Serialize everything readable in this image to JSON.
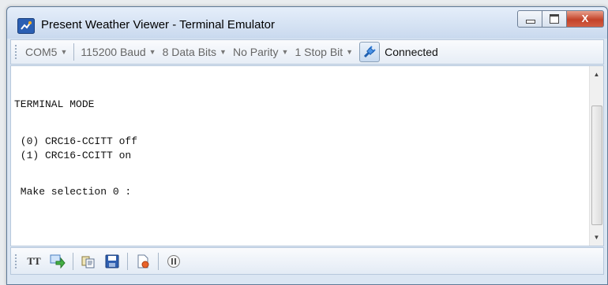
{
  "window": {
    "title": "Present Weather Viewer - Terminal Emulator",
    "close_glyph": "X"
  },
  "toolbar": {
    "port": "COM5",
    "baud": "115200 Baud",
    "data_bits": "8 Data Bits",
    "parity": "No Parity",
    "stop_bits": "1 Stop Bit",
    "connection_status": "Connected",
    "connection_icon": "plug-icon"
  },
  "terminal": {
    "lines": [
      "TERMINAL MODE",
      " (0) CRC16-CCITT off",
      " (1) CRC16-CCITT on",
      " Make selection 0 :"
    ]
  },
  "bottom_toolbar": {
    "tt_label": "TT",
    "icons": [
      "text-mode-icon",
      "send-icon",
      "copy-icon",
      "save-icon",
      "clear-icon",
      "pause-icon"
    ]
  },
  "colors": {
    "close_button": "#c3432a",
    "title_bar": "#dbe6f3"
  }
}
